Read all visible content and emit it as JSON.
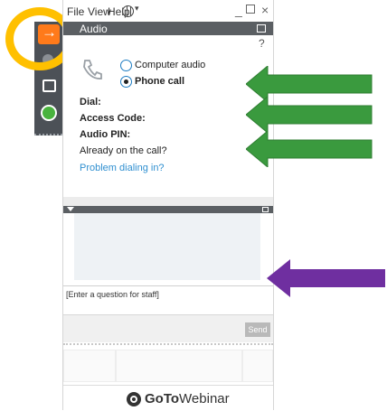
{
  "menu": {
    "file": "File",
    "view": "View",
    "help": "Help"
  },
  "window_controls": {
    "minimize": "_",
    "close": "×"
  },
  "panel": {
    "title": "Audio",
    "help": "?"
  },
  "audio": {
    "computer_audio": "Computer audio",
    "phone_call": "Phone call",
    "selected": "phone_call",
    "dial_label": "Dial:",
    "access_code_label": "Access Code:",
    "audio_pin_label": "Audio PIN:",
    "already_on_call": "Already on the call?",
    "problem_link": "Problem dialing in?"
  },
  "questions": {
    "placeholder": "[Enter a question for staff]",
    "send": "Send"
  },
  "brand": {
    "go_to": "GoTo",
    "webinar": "Webinar"
  },
  "colors": {
    "accent_orange": "#ff7a1a",
    "highlight_yellow": "#ffc000",
    "arrow_green": "#3a9a3e",
    "arrow_purple": "#6f2fa0",
    "link_blue": "#2f8fd0"
  },
  "icons": [
    "arrow-right-icon",
    "gray-circle-icon",
    "screen-icon",
    "raise-hand-icon",
    "globe-icon",
    "phone-icon",
    "popout-icon",
    "gotowebinar-logo-icon"
  ]
}
